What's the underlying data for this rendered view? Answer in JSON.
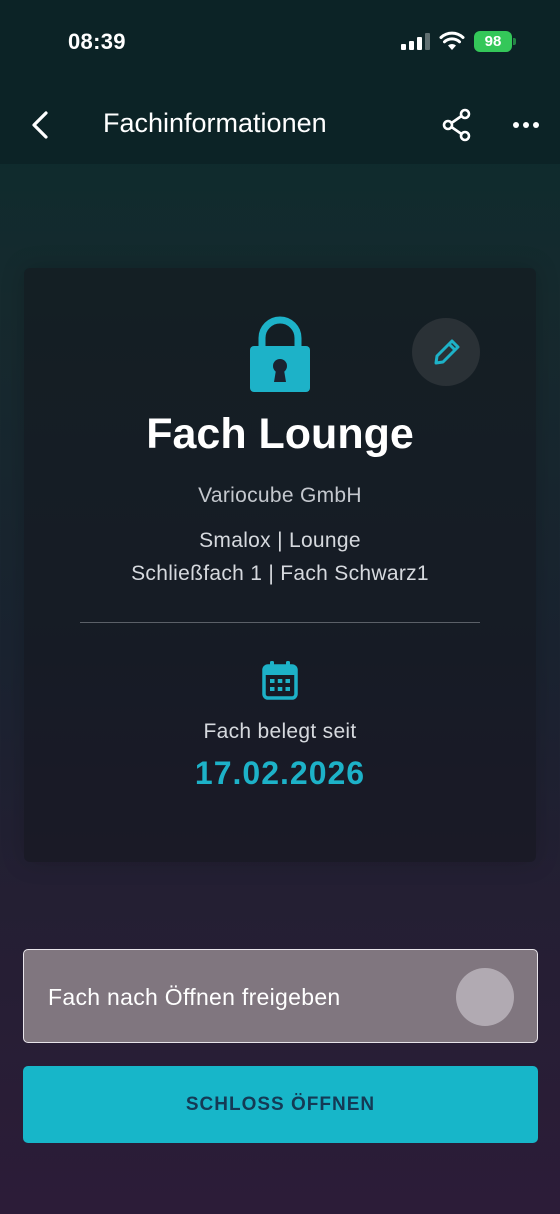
{
  "status_bar": {
    "time": "08:39",
    "battery": "98"
  },
  "header": {
    "title": "Fachinformationen",
    "back_icon": "chevron-left-icon",
    "share_icon": "share-icon",
    "more_icon": "more-horizontal-icon"
  },
  "card": {
    "icon": "lock-icon",
    "edit_icon": "pencil-icon",
    "title": "Fach Lounge",
    "company": "Variocube GmbH",
    "location_line1": "Smalox | Lounge",
    "location_line2": "Schließfach 1 | Fach Schwarz1",
    "date_icon": "calendar-icon",
    "occupied_label": "Fach belegt seit",
    "occupied_date": "17.02.2026"
  },
  "release_toggle": {
    "label": "Fach nach Öffnen freigeben",
    "enabled": false
  },
  "open_button": {
    "label": "SCHLOSS ÖFFNEN"
  },
  "colors": {
    "accent": "#1db2c8",
    "button": "#17b6c9",
    "battery": "#34c759"
  }
}
